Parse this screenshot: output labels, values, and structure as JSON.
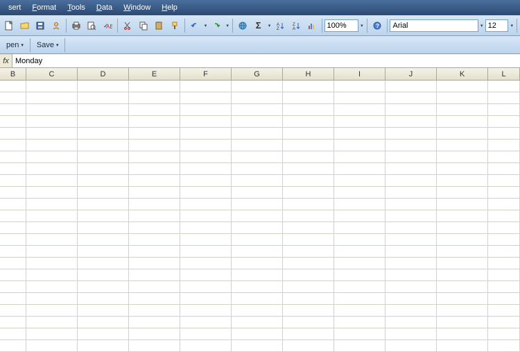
{
  "menubar": {
    "items": [
      {
        "label": "sert",
        "hotkey_prefix": ""
      },
      {
        "label": "ormat",
        "hotkey_prefix": "F"
      },
      {
        "label": "ools",
        "hotkey_prefix": "T"
      },
      {
        "label": "ata",
        "hotkey_prefix": "D"
      },
      {
        "label": "indow",
        "hotkey_prefix": "W"
      },
      {
        "label": "elp",
        "hotkey_prefix": "H"
      }
    ]
  },
  "toolbar": {
    "zoom": "100%",
    "font_name": "Arial",
    "font_size": "12",
    "icons": [
      "new-icon",
      "open-icon",
      "save-icon",
      "permission-icon",
      "print-icon",
      "print-preview-icon",
      "spelling-icon",
      "cut-icon",
      "copy-icon",
      "paste-icon",
      "format-painter-icon",
      "undo-icon",
      "redo-icon",
      "hyperlink-icon",
      "autosum-icon",
      "sort-asc-icon",
      "sort-desc-icon",
      "chart-icon"
    ],
    "help_icon": "help-icon"
  },
  "toolbar2": {
    "open_label": "pen",
    "save_label": "Save"
  },
  "formula_bar": {
    "fx_label": "fx",
    "value": "Monday"
  },
  "columns": [
    "B",
    "C",
    "D",
    "E",
    "F",
    "G",
    "H",
    "I",
    "J",
    "K",
    "L"
  ],
  "row_count": 23
}
